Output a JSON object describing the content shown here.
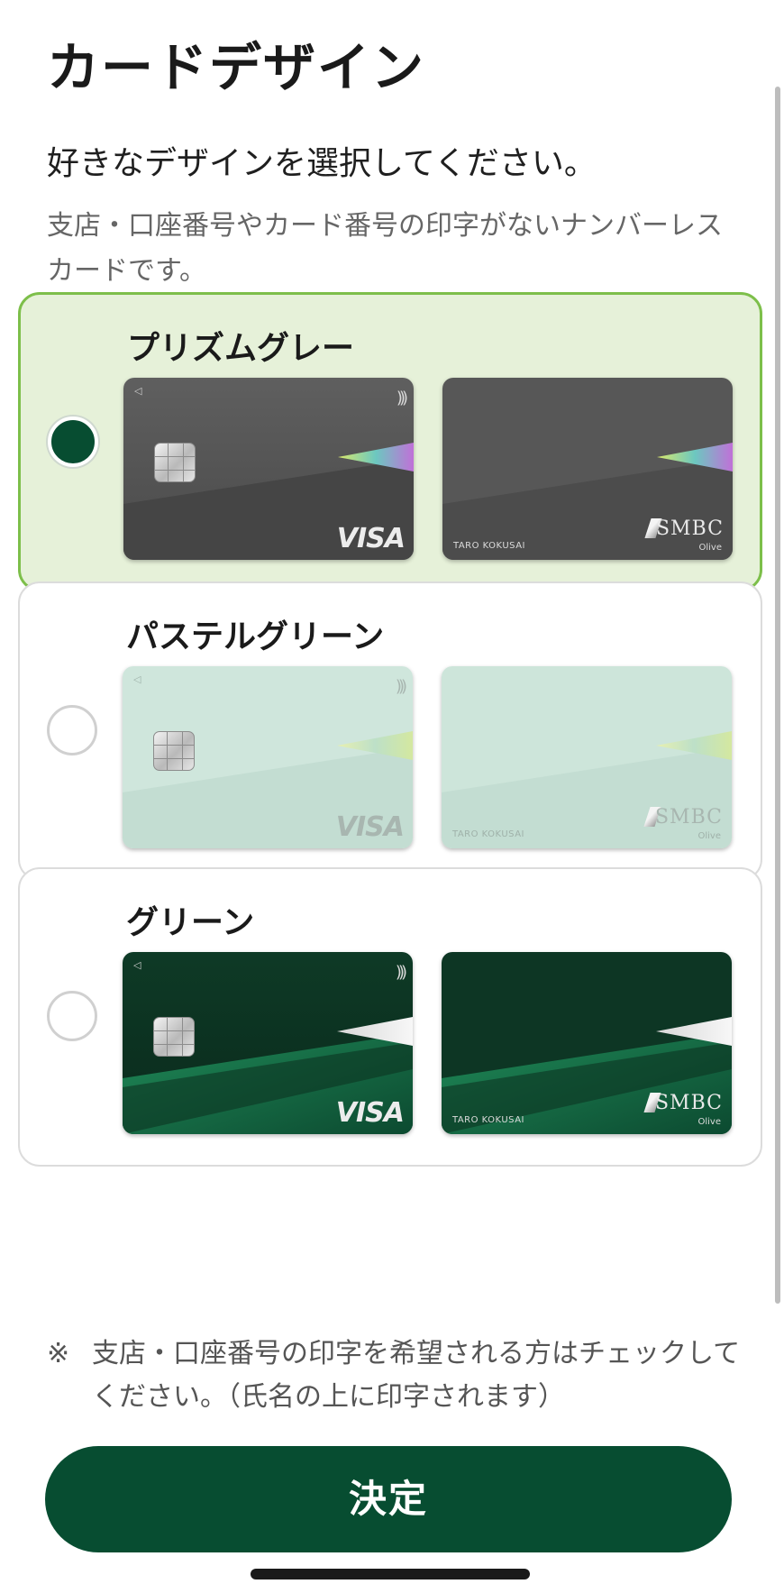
{
  "title": "カードデザイン",
  "lead": "好きなデザインを選択してください。",
  "description": "支店・口座番号やカード番号の印字がないナンバーレスカードです。",
  "options": [
    {
      "label": "プリズムグレー",
      "selected": true,
      "card_color": "#5c5c5c",
      "front": {
        "brand": "VISA"
      },
      "back": {
        "holder": "TARO KOKUSAI",
        "bank": "SMBC",
        "sub": "Olive"
      }
    },
    {
      "label": "パステルグリーン",
      "selected": false,
      "card_color": "#cfe6dc",
      "front": {
        "brand": "VISA"
      },
      "back": {
        "holder": "TARO KOKUSAI",
        "bank": "SMBC",
        "sub": "Olive"
      }
    },
    {
      "label": "グリーン",
      "selected": false,
      "card_color": "#0f5a3a",
      "front": {
        "brand": "VISA"
      },
      "back": {
        "holder": "TARO KOKUSAI",
        "bank": "SMBC",
        "sub": "Olive"
      }
    }
  ],
  "note": {
    "mark": "※",
    "text": "支店・口座番号の印字を希望される方はチェックしてください。（氏名の上に印字されます）"
  },
  "submit_label": "決定",
  "colors": {
    "primary": "#074d31",
    "selected_border": "#7dbf4a",
    "selected_bg": "#e6f1d9"
  },
  "icons": [
    "radio-selected-icon",
    "radio-icon",
    "chip-icon",
    "contactless-icon"
  ]
}
